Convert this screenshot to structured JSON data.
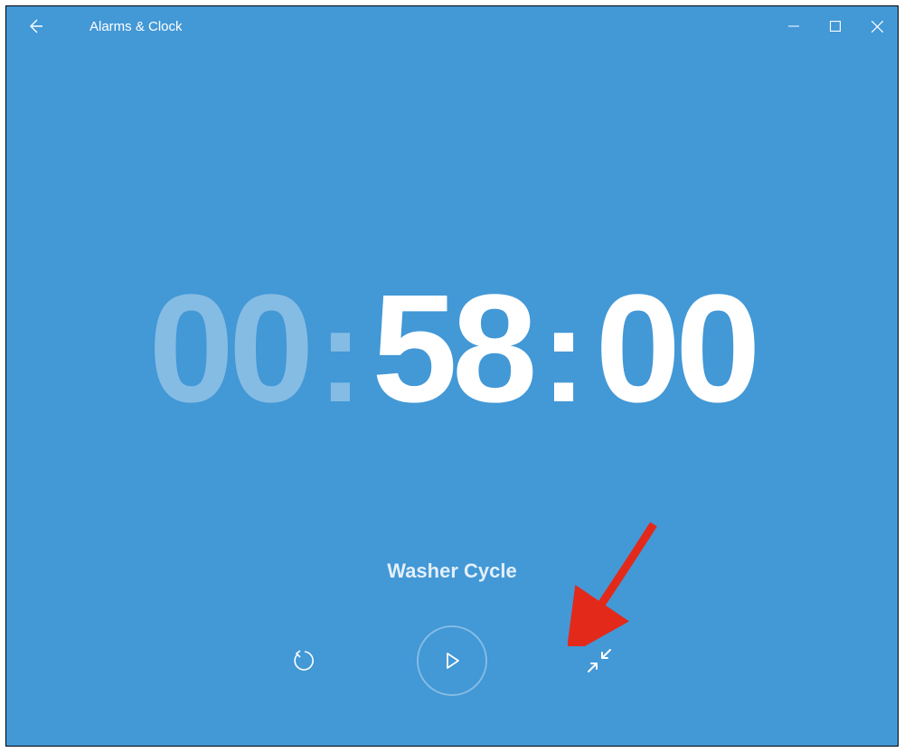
{
  "window": {
    "title": "Alarms & Clock"
  },
  "timer": {
    "hours": "00",
    "minutes": "58",
    "seconds": "00",
    "label": "Washer Cycle"
  },
  "icons": {
    "back": "back-arrow",
    "minimize": "minimize",
    "maximize": "maximize",
    "close": "close",
    "reset": "reset-ccw",
    "play": "play",
    "collapse": "collapse-arrows"
  },
  "colors": {
    "background": "#4398d6",
    "foreground": "#ffffff",
    "annotation": "#e3291a"
  }
}
